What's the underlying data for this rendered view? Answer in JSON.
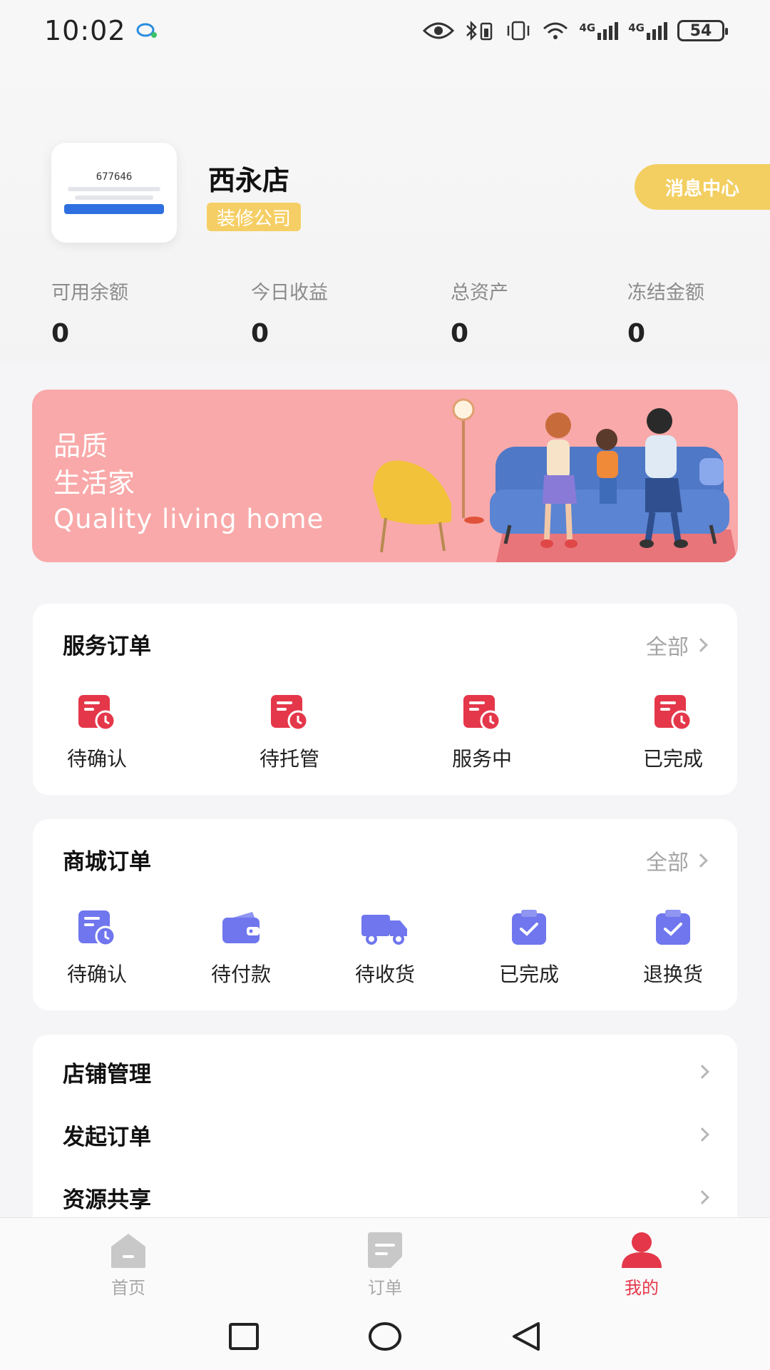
{
  "status_bar": {
    "time": "10:02",
    "network_labels": [
      "4G",
      "4G"
    ],
    "battery": "54"
  },
  "profile": {
    "avatar_code": "677646",
    "shop_name": "西永店",
    "shop_tag": "装修公司",
    "message_center": "消息中心"
  },
  "stats": [
    {
      "label": "可用余额",
      "value": "0"
    },
    {
      "label": "今日收益",
      "value": "0"
    },
    {
      "label": "总资产",
      "value": "0"
    },
    {
      "label": "冻结金额",
      "value": "0"
    }
  ],
  "banner": {
    "line1": "品质",
    "line2": "生活家",
    "line3": "Quality living home"
  },
  "service_orders": {
    "title": "服务订单",
    "all_label": "全部",
    "items": [
      {
        "label": "待确认",
        "icon": "order-clock-icon"
      },
      {
        "label": "待托管",
        "icon": "order-clock-icon"
      },
      {
        "label": "服务中",
        "icon": "order-clock-icon"
      },
      {
        "label": "已完成",
        "icon": "order-clock-icon"
      }
    ]
  },
  "mall_orders": {
    "title": "商城订单",
    "all_label": "全部",
    "items": [
      {
        "label": "待确认",
        "icon": "order-clock-icon"
      },
      {
        "label": "待付款",
        "icon": "wallet-icon"
      },
      {
        "label": "待收货",
        "icon": "truck-icon"
      },
      {
        "label": "已完成",
        "icon": "clipboard-check-icon"
      },
      {
        "label": "退换货",
        "icon": "clipboard-check-icon"
      }
    ]
  },
  "menu": [
    {
      "label": "店铺管理"
    },
    {
      "label": "发起订单"
    },
    {
      "label": "资源共享"
    }
  ],
  "tabbar": [
    {
      "label": "首页",
      "icon": "home-icon",
      "active": false
    },
    {
      "label": "订单",
      "icon": "order-tab-icon",
      "active": false
    },
    {
      "label": "我的",
      "icon": "user-icon",
      "active": true
    }
  ],
  "colors": {
    "accent_red": "#e5374a",
    "accent_purple": "#6f76ee",
    "tag_yellow": "#f3cf62",
    "banner_pink": "#f9a9a9"
  }
}
